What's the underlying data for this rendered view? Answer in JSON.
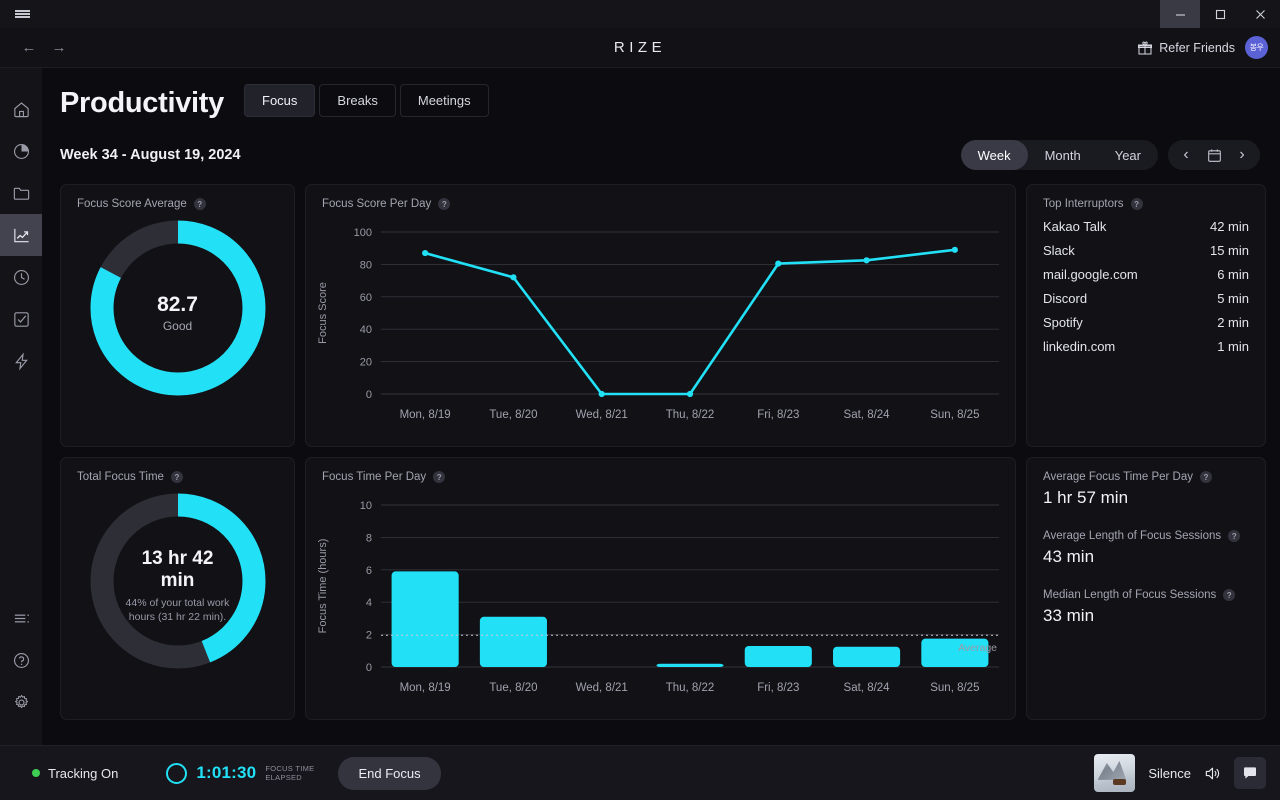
{
  "window": {
    "menu_icon": "hamburger-icon",
    "minimize_label": "–",
    "maximize_label": "□",
    "close_label": "✕"
  },
  "navbar": {
    "back_label": "←",
    "forward_label": "→",
    "brand": "RIZE",
    "refer_label": "Refer Friends",
    "refer_icon": "gift-icon",
    "avatar_initials": "봉우"
  },
  "sidebar": {
    "items": [
      {
        "name": "home",
        "icon": "home-icon",
        "active": false
      },
      {
        "name": "dashboard",
        "icon": "pie-chart-icon",
        "active": false
      },
      {
        "name": "projects",
        "icon": "folder-icon",
        "active": false
      },
      {
        "name": "productivity",
        "icon": "trending-up-icon",
        "active": true
      },
      {
        "name": "time",
        "icon": "clock-icon",
        "active": false
      },
      {
        "name": "tasks",
        "icon": "check-square-icon",
        "active": false
      },
      {
        "name": "focus",
        "icon": "lightning-icon",
        "active": false
      }
    ],
    "bottom": [
      {
        "name": "sessions",
        "icon": "list-icon"
      },
      {
        "name": "help",
        "icon": "help-circle-icon"
      },
      {
        "name": "settings",
        "icon": "gear-icon"
      }
    ]
  },
  "page": {
    "title": "Productivity",
    "tabs": [
      {
        "label": "Focus",
        "active": true
      },
      {
        "label": "Breaks",
        "active": false
      },
      {
        "label": "Meetings",
        "active": false
      }
    ],
    "week_label": "Week 34 - August 19, 2024",
    "range_options": [
      {
        "label": "Week",
        "active": true
      },
      {
        "label": "Month",
        "active": false
      },
      {
        "label": "Year",
        "active": false
      }
    ],
    "nav": {
      "prev_label": "‹",
      "calendar_icon": "calendar-icon",
      "next_label": "›"
    }
  },
  "colors": {
    "accent": "#22e0f5",
    "track": "#2e2e36",
    "card_bg": "#111116",
    "page_bg": "#0c0c10",
    "green": "#3ecf54",
    "avatar": "#5b62d6"
  },
  "cards": {
    "focus_score_average": {
      "title": "Focus Score Average",
      "help": "?",
      "value": "82.7",
      "sublabel": "Good",
      "percent": 82.7
    },
    "total_focus_time": {
      "title": "Total Focus Time",
      "help": "?",
      "value": "13 hr 42 min",
      "note": "44% of your total work hours (31 hr 22 min).",
      "percent": 44
    },
    "top_interruptors": {
      "title": "Top Interruptors",
      "help": "?",
      "rows": [
        {
          "name": "Kakao Talk",
          "value": "42 min"
        },
        {
          "name": "Slack",
          "value": "15 min"
        },
        {
          "name": "mail.google.com",
          "value": "6 min"
        },
        {
          "name": "Discord",
          "value": "5 min"
        },
        {
          "name": "Spotify",
          "value": "2 min"
        },
        {
          "name": "linkedin.com",
          "value": "1 min"
        }
      ]
    },
    "stats": {
      "items": [
        {
          "label": "Average Focus Time Per Day",
          "help": "?",
          "value": "1 hr 57 min"
        },
        {
          "label": "Average Length of Focus Sessions",
          "help": "?",
          "value": "43 min"
        },
        {
          "label": "Median Length of Focus Sessions",
          "help": "?",
          "value": "33 min"
        }
      ]
    }
  },
  "chart_data": [
    {
      "type": "line",
      "title": "Focus Score Per Day",
      "help": "?",
      "xlabel": "",
      "ylabel": "Focus Score",
      "categories": [
        "Mon, 8/19",
        "Tue, 8/20",
        "Wed, 8/21",
        "Thu, 8/22",
        "Fri, 8/23",
        "Sat, 8/24",
        "Sun, 8/25"
      ],
      "values": [
        87,
        72,
        0,
        0,
        80.5,
        82.5,
        89
      ],
      "yticks": [
        0,
        20,
        40,
        60,
        80,
        100
      ],
      "ylim": [
        0,
        100
      ],
      "grid": true,
      "legend": "none",
      "color": "#22e0f5"
    },
    {
      "type": "bar",
      "title": "Focus Time Per Day",
      "help": "?",
      "xlabel": "",
      "ylabel": "Focus Time (hours)",
      "categories": [
        "Mon, 8/19",
        "Tue, 8/20",
        "Wed, 8/21",
        "Thu, 8/22",
        "Fri, 8/23",
        "Sat, 8/24",
        "Sun, 8/25"
      ],
      "values": [
        5.9,
        3.1,
        0,
        0.2,
        1.3,
        1.25,
        1.75
      ],
      "yticks": [
        0,
        2,
        4,
        6,
        8,
        10
      ],
      "ylim": [
        0,
        10
      ],
      "grid": true,
      "legend": "none",
      "color": "#22e0f5",
      "average_line": {
        "value": 1.96,
        "label": "Average"
      }
    }
  ],
  "statusbar": {
    "tracking_label": "Tracking On",
    "timer_value": "1:01:30",
    "timer_caption_line1": "FOCUS TIME",
    "timer_caption_line2": "ELAPSED",
    "end_focus_label": "End Focus",
    "sound_label": "Silence",
    "speaker_icon": "speaker-icon",
    "chat_icon": "chat-icon"
  }
}
